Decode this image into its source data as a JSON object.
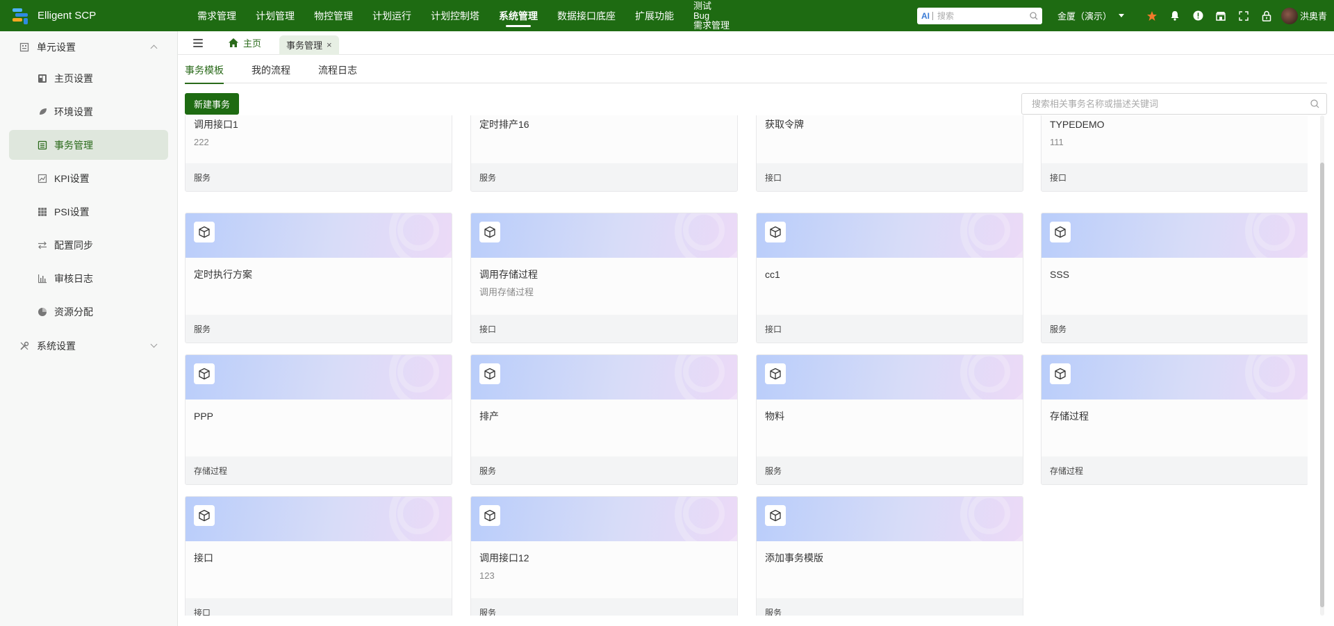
{
  "app": {
    "title": "Elligent SCP"
  },
  "colors": {
    "brand_green": "#1e6b12",
    "accent_green": "#2a6a1a",
    "star_orange": "#f07a2a"
  },
  "topnav": {
    "items": [
      {
        "label": "需求管理",
        "active": false
      },
      {
        "label": "计划管理",
        "active": false
      },
      {
        "label": "物控管理",
        "active": false
      },
      {
        "label": "计划运行",
        "active": false
      },
      {
        "label": "计划控制塔",
        "active": false
      },
      {
        "label": "系统管理",
        "active": true
      },
      {
        "label": "数据接口底座",
        "active": false
      },
      {
        "label": "扩展功能",
        "active": false
      }
    ],
    "multi_item": {
      "line1": "测试",
      "line2": "Bug",
      "line3": "需求管理"
    }
  },
  "header": {
    "search_placeholder": "搜索",
    "search_ai_label": "AI",
    "tenant": "金厦（演示）",
    "user_name": "洪奥青",
    "icons": [
      "star-icon",
      "bell-icon",
      "alert-icon",
      "store-icon",
      "fullscreen-icon",
      "lock-icon"
    ]
  },
  "sidebar": {
    "group1": {
      "label": "单元设置",
      "expanded": true,
      "icon": "building-icon"
    },
    "items": [
      {
        "label": "主页设置",
        "icon": "dashboard-icon",
        "active": false
      },
      {
        "label": "环境设置",
        "icon": "leaf-icon",
        "active": false
      },
      {
        "label": "事务管理",
        "icon": "list-icon",
        "active": true
      },
      {
        "label": "KPI设置",
        "icon": "chart-line-icon",
        "active": false
      },
      {
        "label": "PSI设置",
        "icon": "grid-icon",
        "active": false
      },
      {
        "label": "配置同步",
        "icon": "sync-icon",
        "active": false
      },
      {
        "label": "审核日志",
        "icon": "bar-chart-icon",
        "active": false
      },
      {
        "label": "资源分配",
        "icon": "pie-icon",
        "active": false
      }
    ],
    "group2": {
      "label": "系统设置",
      "expanded": false,
      "icon": "tools-icon"
    }
  },
  "tabs": {
    "home": "主页",
    "active": "事务管理",
    "close": "×"
  },
  "subtabs": [
    {
      "label": "事务模板",
      "active": true
    },
    {
      "label": "我的流程",
      "active": false
    },
    {
      "label": "流程日志",
      "active": false
    }
  ],
  "toolbar": {
    "new_label": "新建事务",
    "search_placeholder": "搜索相关事务名称或描述关键词"
  },
  "cards": [
    {
      "title": "调用接口1",
      "desc": "222",
      "type": "服务",
      "banner": false
    },
    {
      "title": "定时排产16",
      "desc": "",
      "type": "服务",
      "banner": false
    },
    {
      "title": "获取令牌",
      "desc": "",
      "type": "接口",
      "banner": false
    },
    {
      "title": "TYPEDEMO",
      "desc": "111",
      "type": "接口",
      "banner": false
    },
    {
      "title": "定时执行方案",
      "desc": "",
      "type": "服务",
      "banner": true
    },
    {
      "title": "调用存储过程",
      "desc": "调用存储过程",
      "type": "接口",
      "banner": true
    },
    {
      "title": "cc1",
      "desc": "",
      "type": "接口",
      "banner": true
    },
    {
      "title": "SSS",
      "desc": "",
      "type": "服务",
      "banner": true
    },
    {
      "title": "PPP",
      "desc": "",
      "type": "存储过程",
      "banner": true
    },
    {
      "title": "排产",
      "desc": "",
      "type": "服务",
      "banner": true
    },
    {
      "title": "物料",
      "desc": "",
      "type": "服务",
      "banner": true
    },
    {
      "title": "存储过程",
      "desc": "",
      "type": "存储过程",
      "banner": true
    },
    {
      "title": "接口",
      "desc": "",
      "type": "接口",
      "banner": true
    },
    {
      "title": "调用接口12",
      "desc": "123",
      "type": "服务",
      "banner": true
    },
    {
      "title": "添加事务模版",
      "desc": "",
      "type": "服务",
      "banner": true
    }
  ]
}
